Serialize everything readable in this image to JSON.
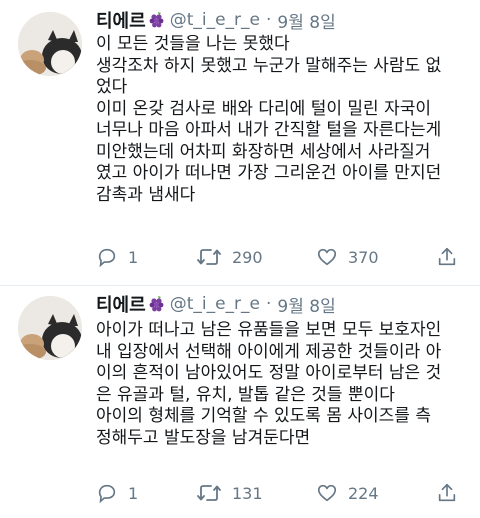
{
  "tweets": [
    {
      "author": {
        "name": "티에르",
        "handle": "@t_i_e_r_e",
        "separator": "·",
        "date": "9월 8일"
      },
      "lines": [
        "이 모든 것들을 나는 못했다",
        "생각조차 하지 못했고 누군가 말해주는 사람도 없",
        "었다",
        "이미 온갖 검사로 배와 다리에 털이 밀린 자국이",
        "너무나 마음 아파서 내가 간직할 털을 자른다는게",
        "미안했는데 어차피 화장하면 세상에서 사라질거",
        "였고 아이가 떠나면 가장 그리운건 아이를 만지던",
        "감촉과 냄새다"
      ],
      "stats": {
        "replies": "1",
        "retweets": "290",
        "likes": "370"
      }
    },
    {
      "author": {
        "name": "티에르",
        "handle": "@t_i_e_r_e",
        "separator": "·",
        "date": "9월 8일"
      },
      "lines": [
        "아이가 떠나고 남은 유품들을 보면 모두 보호자인",
        "내 입장에서 선택해 아이에게 제공한 것들이라 아",
        "이의 흔적이 남아있어도 정말 아이로부터 남은 것",
        "은 유골과 털, 유치, 발톱 같은 것들 뿐이다",
        "아이의 형체를 기억할 수 있도록 몸 사이즈를 측",
        "정해두고 발도장을 남겨둔다면"
      ],
      "stats": {
        "replies": "1",
        "retweets": "131",
        "likes": "224"
      }
    }
  ],
  "icons": {
    "name_emoji": "grapes-emoji",
    "reply": "reply-icon",
    "retweet": "retweet-icon",
    "like": "heart-icon",
    "share": "share-icon"
  },
  "colors": {
    "text": "#14171a",
    "secondary": "#657786",
    "divider": "#e6ecf0",
    "grape": "#7b3fa0"
  }
}
